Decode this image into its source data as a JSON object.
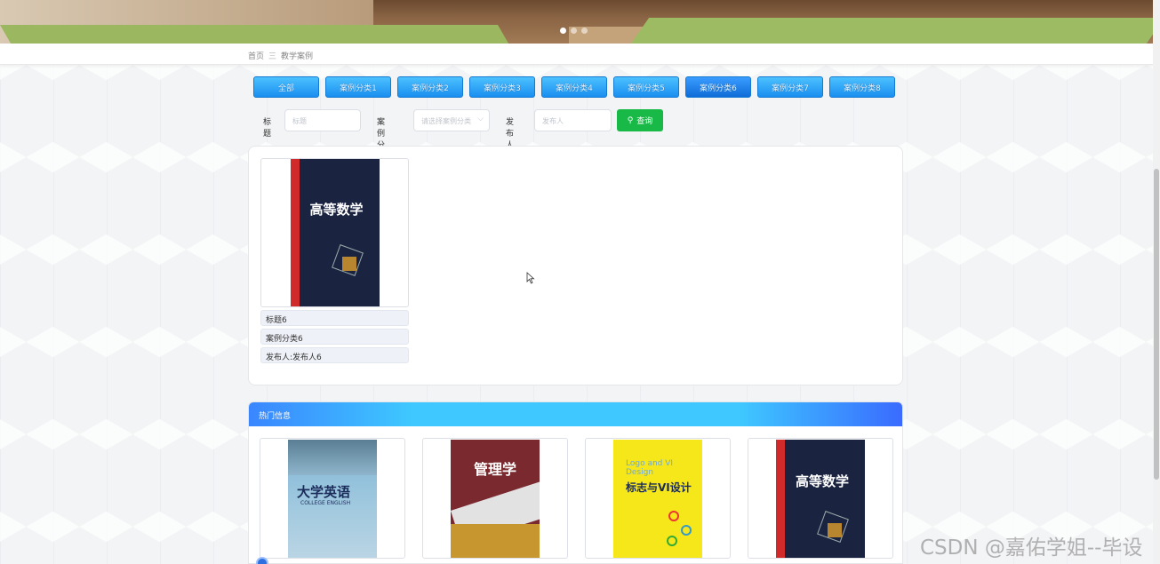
{
  "banner": {
    "dots": 3,
    "active_dot": 1
  },
  "breadcrumb": {
    "home": "首页",
    "separator": "三",
    "current": "教学案例"
  },
  "categories": [
    {
      "label": "全部",
      "active": false
    },
    {
      "label": "案例分类1",
      "active": false
    },
    {
      "label": "案例分类2",
      "active": false
    },
    {
      "label": "案例分类3",
      "active": false
    },
    {
      "label": "案例分类4",
      "active": false
    },
    {
      "label": "案例分类5",
      "active": false
    },
    {
      "label": "案例分类6",
      "active": true
    },
    {
      "label": "案例分类7",
      "active": false
    },
    {
      "label": "案例分类8",
      "active": false
    }
  ],
  "filters": {
    "title_label": "标题",
    "title_placeholder": "标题",
    "category_label": "案例分类",
    "category_placeholder": "请选择案例分类",
    "publisher_label": "发布人",
    "publisher_placeholder": "发布人",
    "search_button": "查询"
  },
  "result": {
    "title": "标题6",
    "category": "案例分类6",
    "publisher": "发布人:发布人6",
    "cover_text": "高等数学"
  },
  "hot": {
    "heading": "热门信息",
    "items": [
      {
        "cover_title": "大学英语",
        "cover_sub": "COLLEGE ENGLISH"
      },
      {
        "cover_title": "管理学"
      },
      {
        "cover_title": "标志与VI设计",
        "cover_sub": "Logo and VI Design"
      },
      {
        "cover_title": "高等数学"
      }
    ]
  },
  "watermark": "CSDN @嘉佑学姐--毕设"
}
